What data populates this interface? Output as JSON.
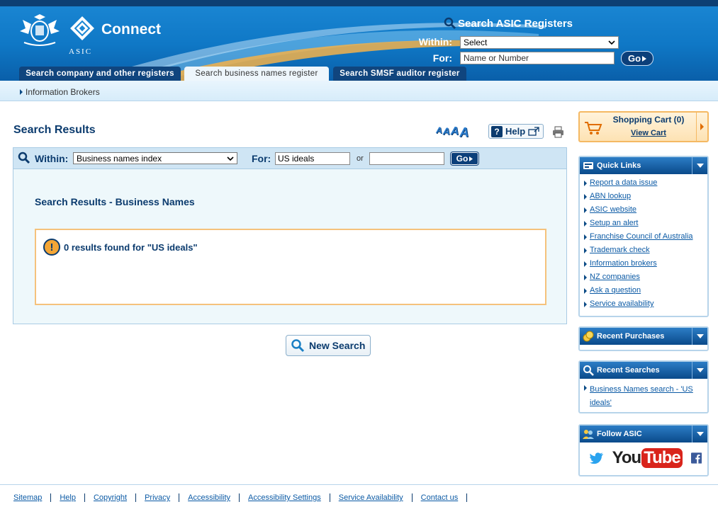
{
  "header": {
    "brand": "Connect",
    "org": "ASIC",
    "search_title": "Search ASIC Registers",
    "within_label": "Within:",
    "within_value": "Select",
    "for_label": "For:",
    "for_placeholder": "Name or Number",
    "go_label": "Go"
  },
  "tabs": [
    {
      "label": "Search company and other registers"
    },
    {
      "label": "Search business names register"
    },
    {
      "label": "Search SMSF auditor register"
    }
  ],
  "subnav": {
    "link": "Information Brokers"
  },
  "main": {
    "title": "Search Results",
    "font_size_glyph": "A",
    "help_label": "Help",
    "search": {
      "within_label": "Within:",
      "within_value": "Business names index",
      "for_label": "For:",
      "for_value": "US ideals",
      "or_label": "or",
      "go_label": "Go"
    },
    "results_heading": "Search Results - Business Names",
    "no_results": "0 results found for \"US ideals\"",
    "new_search_label": "New Search"
  },
  "cart": {
    "title": "Shopping Cart (0)",
    "link": "View Cart"
  },
  "quick_links": {
    "title": "Quick Links",
    "items": [
      "Report a data issue",
      "ABN lookup",
      "ASIC website",
      "Setup an alert",
      "Franchise Council of Australia",
      "Trademark check",
      "Information brokers",
      "NZ companies",
      "Ask a question",
      "Service availability"
    ]
  },
  "recent_purchases": {
    "title": "Recent Purchases"
  },
  "recent_searches": {
    "title": "Recent Searches",
    "items": [
      "Business Names search - 'US ideals'"
    ]
  },
  "follow": {
    "title": "Follow ASIC",
    "youtube_you": "You",
    "youtube_tube": "Tube"
  },
  "footer": {
    "links": [
      "Sitemap",
      "Help",
      "Copyright",
      "Privacy",
      "Accessibility",
      "Accessibility Settings",
      "Service Availability",
      "Contact us"
    ]
  },
  "colors": {
    "brand_blue": "#0b3b6e",
    "header_blue": "#1b87d4",
    "accent_orange": "#f5b963",
    "link": "#0b5aa5"
  }
}
